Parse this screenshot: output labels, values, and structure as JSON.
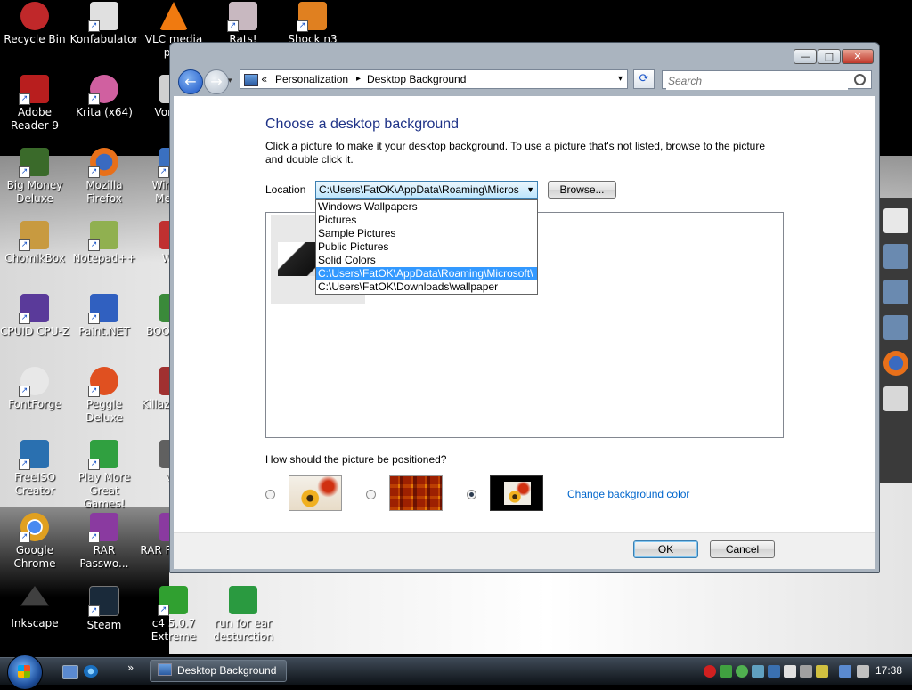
{
  "desktop": {
    "icons": [
      {
        "label": "Recycle Bin",
        "color": "#c0282a"
      },
      {
        "label": "Konfabulator",
        "color": "#e0e0e0"
      },
      {
        "label": "VLC media pl...",
        "color": "#f07a10"
      },
      {
        "label": "Rats!",
        "color": "#c8b8c0"
      },
      {
        "label": "Shock n3",
        "color": "#e08020"
      },
      {
        "label": "Adobe Reader 9",
        "color": "#b81e1e"
      },
      {
        "label": "Krita (x64)",
        "color": "#d060a0"
      },
      {
        "label": "Vorte...",
        "color": "#d0d0d0"
      },
      {
        "label": "Big Money Deluxe",
        "color": "#3a6a2a"
      },
      {
        "label": "Mozilla Firefox",
        "color": "#e8701a"
      },
      {
        "label": "Windo... Mess...",
        "color": "#3a70c0"
      },
      {
        "label": "ChomikBox",
        "color": "#c89a40"
      },
      {
        "label": "Notepad++",
        "color": "#90b050"
      },
      {
        "label": "Wi...",
        "color": "#c03030"
      },
      {
        "label": "CPUID CPU-Z",
        "color": "#5a3a9a"
      },
      {
        "label": "Paint.NET",
        "color": "#3060c0"
      },
      {
        "label": "BOO... N...",
        "color": "#3a8a3a"
      },
      {
        "label": "FontForge",
        "color": "#e8e8e8"
      },
      {
        "label": "Peggle Deluxe",
        "color": "#e05020"
      },
      {
        "label": "Killaz MPE...",
        "color": "#a03030"
      },
      {
        "label": "FreeISO Creator",
        "color": "#2a70b0"
      },
      {
        "label": "Play More Great Games!",
        "color": "#30a040"
      },
      {
        "label": "v...",
        "color": "#606060"
      },
      {
        "label": "Google Chrome",
        "color": "#e0a020"
      },
      {
        "label": "RAR Passwo...",
        "color": "#8a3aa0"
      },
      {
        "label": "RAR R... To...",
        "color": "#8a3aa0"
      },
      {
        "label": "Inkscape",
        "color": "#404040"
      },
      {
        "label": "Steam",
        "color": "#1a2a3a"
      },
      {
        "label": "c4 5.0.7 Extreme",
        "color": "#30a030"
      },
      {
        "label": "run for ear desturction",
        "color": "#2a9a40"
      }
    ]
  },
  "window": {
    "title_buttons": {
      "minimize": "—",
      "maximize": "□",
      "close": "✕"
    },
    "nav": {
      "back_glyph": "←",
      "forward_glyph": "→",
      "dropdown_glyph": "▾"
    },
    "address": {
      "prefix": "«",
      "crumb1": "Personalization",
      "separator": "▸",
      "crumb2": "Desktop Background",
      "dropdown_glyph": "▾"
    },
    "refresh_glyph": "⟳",
    "search": {
      "placeholder": "Search",
      "icon": "magnifier-icon"
    },
    "content": {
      "heading": "Choose a desktop background",
      "description": "Click a picture to make it your desktop background. To use a picture that's not listed, browse to the picture and double click it.",
      "location_label": "Location",
      "location_value": "C:\\Users\\FatOK\\AppData\\Roaming\\Micros",
      "browse_label": "Browse...",
      "location_options": [
        "Windows Wallpapers",
        "Pictures",
        "Sample Pictures",
        "Public Pictures",
        "Solid Colors",
        "C:\\Users\\FatOK\\AppData\\Roaming\\Microsoft\\",
        "C:\\Users\\FatOK\\Downloads\\wallpaper"
      ],
      "selected_option_index": 5,
      "position_question": "How should the picture be positioned?",
      "position_selected_index": 2,
      "change_color_link": "Change background color"
    },
    "footer": {
      "ok_label": "OK",
      "cancel_label": "Cancel"
    }
  },
  "taskbar": {
    "task_label": "Desktop Background",
    "overflow_glyph": "»",
    "clock": "17:38"
  },
  "colors": {
    "accent_heading": "#1e3287",
    "link": "#0066cc",
    "selection": "#3399ff"
  }
}
